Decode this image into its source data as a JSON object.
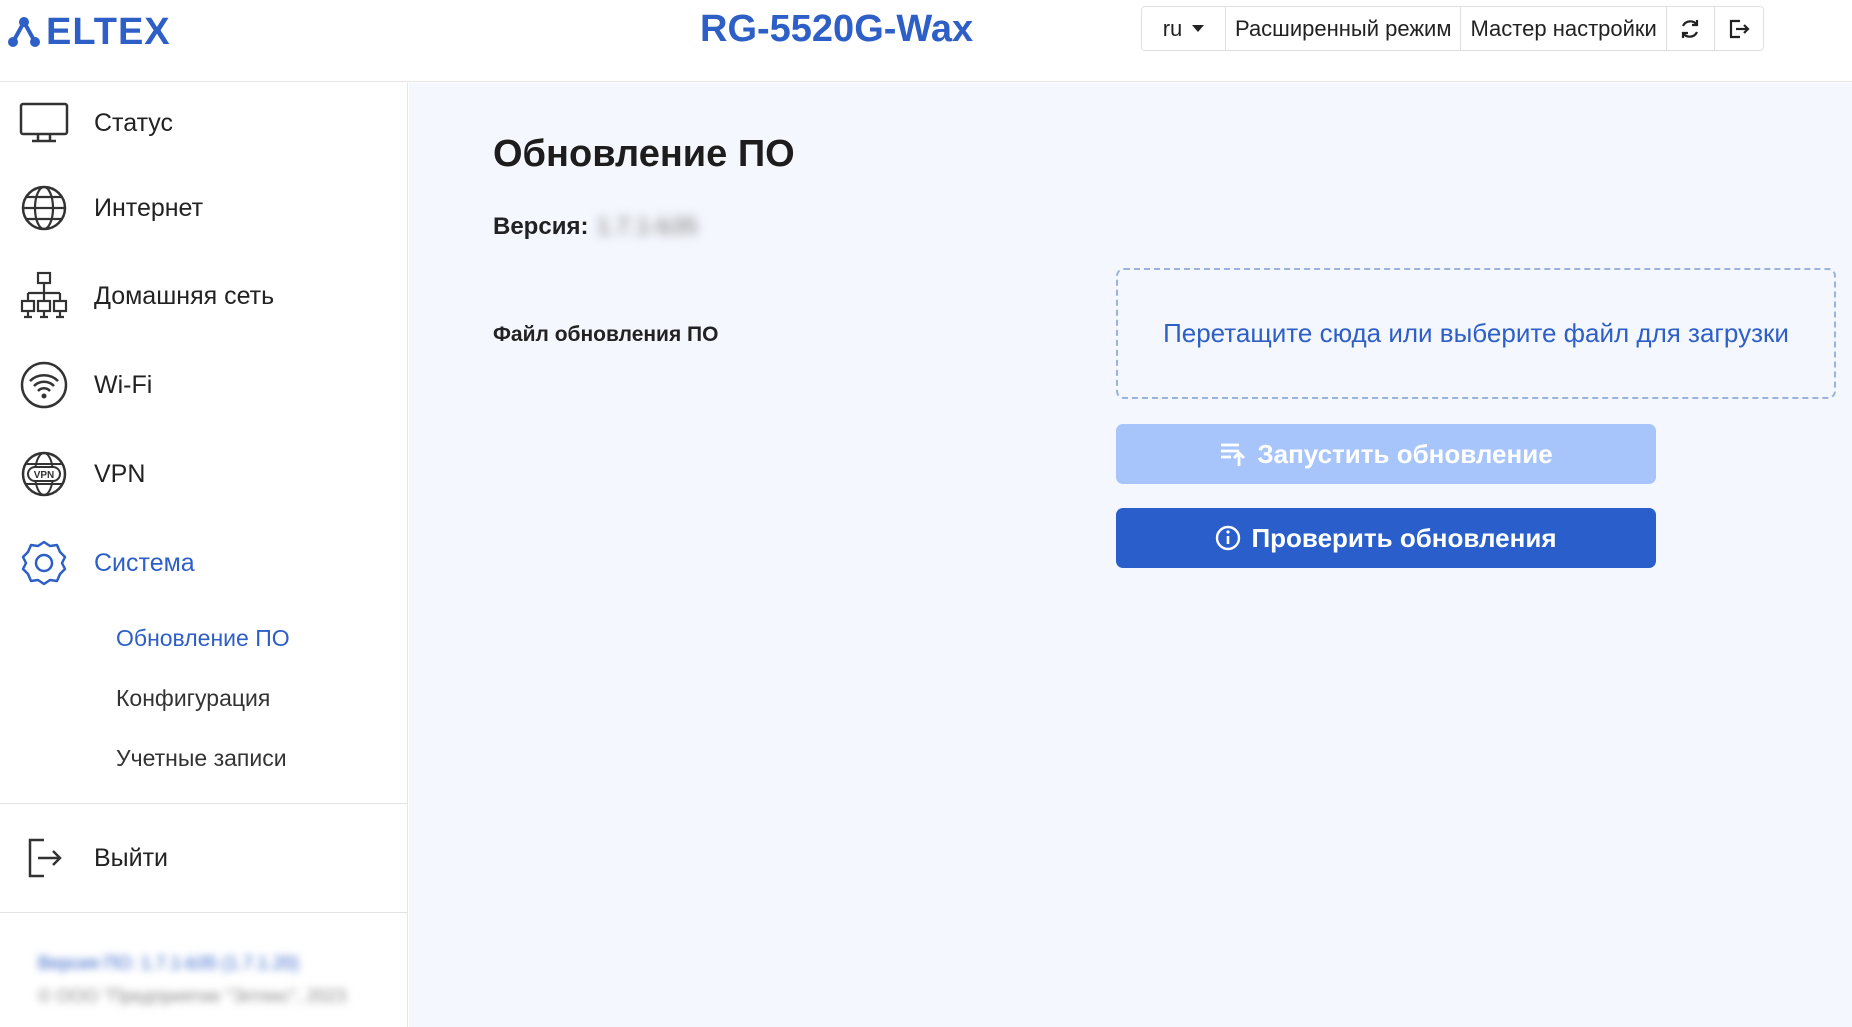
{
  "header": {
    "logo_text": "ELTEX",
    "device_title": "RG-5520G-Wax",
    "lang": "ru",
    "advanced_mode": "Расширенный режим",
    "setup_wizard": "Мастер настройки"
  },
  "sidebar": {
    "items": [
      {
        "label": "Статус",
        "icon": "monitor-icon"
      },
      {
        "label": "Интернет",
        "icon": "globe-icon"
      },
      {
        "label": "Домашняя сеть",
        "icon": "network-icon"
      },
      {
        "label": "Wi-Fi",
        "icon": "wifi-icon"
      },
      {
        "label": "VPN",
        "icon": "vpn-icon"
      },
      {
        "label": "Система",
        "icon": "gear-icon"
      }
    ],
    "subitems": [
      {
        "label": "Обновление ПО"
      },
      {
        "label": "Конфигурация"
      },
      {
        "label": "Учетные записи"
      }
    ],
    "logout": "Выйти",
    "footer_version": "Версия ПО: 1.7.1-b35 (1.7.1.20)",
    "footer_copyright": "© ООО \"Предприятие \"Элтекс\", 2023"
  },
  "main": {
    "title": "Обновление ПО",
    "version_label": "Версия:",
    "version_value": "1.7.1-b35",
    "file_label": "Файл обновления ПО",
    "dropzone_text": "Перетащите сюда или выберите файл для загрузки",
    "start_update": "Запустить обновление",
    "check_updates": "Проверить обновления"
  },
  "colors": {
    "accent": "#2d5fc7",
    "button_primary": "#2a5fcb",
    "button_disabled": "#a7c5fb",
    "main_bg": "#f4f7fd"
  }
}
